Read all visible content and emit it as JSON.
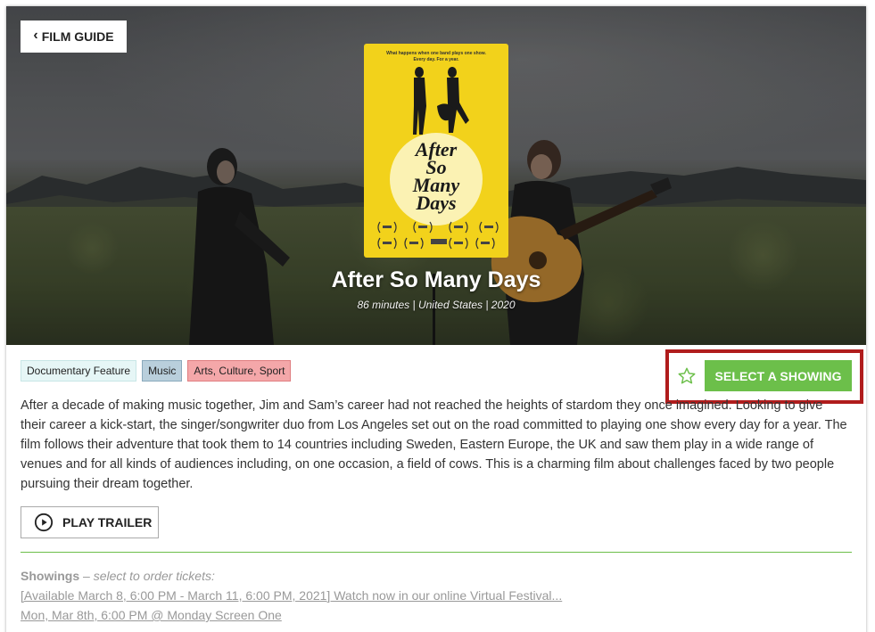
{
  "nav": {
    "back_label": "FILM GUIDE"
  },
  "film": {
    "title": "After So Many Days",
    "meta": "86 minutes | United States | 2020",
    "tags": [
      "Documentary Feature",
      "Music",
      "Arts, Culture, Sport"
    ],
    "description": "After a decade of making music together, Jim and Sam’s career had not reached the heights of stardom they once imagined. Looking to give their career a kick-start, the singer/songwriter duo from Los Angeles set out on the road committed to playing one show every day for a year. The film follows their adventure that took them to 14 countries including Sweden, Eastern Europe, the UK and saw them play in a wide range of venues and for all kinds of audiences including, on one occasion, a field of cows. This is a charming film about challenges faced by two people pursuing their dream together."
  },
  "poster": {
    "tagline_line1": "What happens when one band plays one show.",
    "tagline_line2": "Every day. For a year.",
    "title_line1": "After",
    "title_line2": "So",
    "title_line3": "Many",
    "title_line4": "Days"
  },
  "actions": {
    "favorite_icon": "star-outline-icon",
    "select_label": "SELECT A SHOWING",
    "trailer_label": "PLAY TRAILER",
    "trailer_icon": "play-circle-icon"
  },
  "showings": {
    "heading": "Showings",
    "subheading": "select to order tickets:",
    "items": [
      "[Available March 8, 6:00 PM - March 11, 6:00 PM, 2021] Watch now in our online Virtual Festival...",
      "Mon, Mar 8th, 6:00 PM @ Monday Screen One"
    ]
  },
  "colors": {
    "accent_green": "#6cbf4a",
    "highlight_red": "#b01c1c",
    "poster_yellow": "#f2d21b"
  }
}
